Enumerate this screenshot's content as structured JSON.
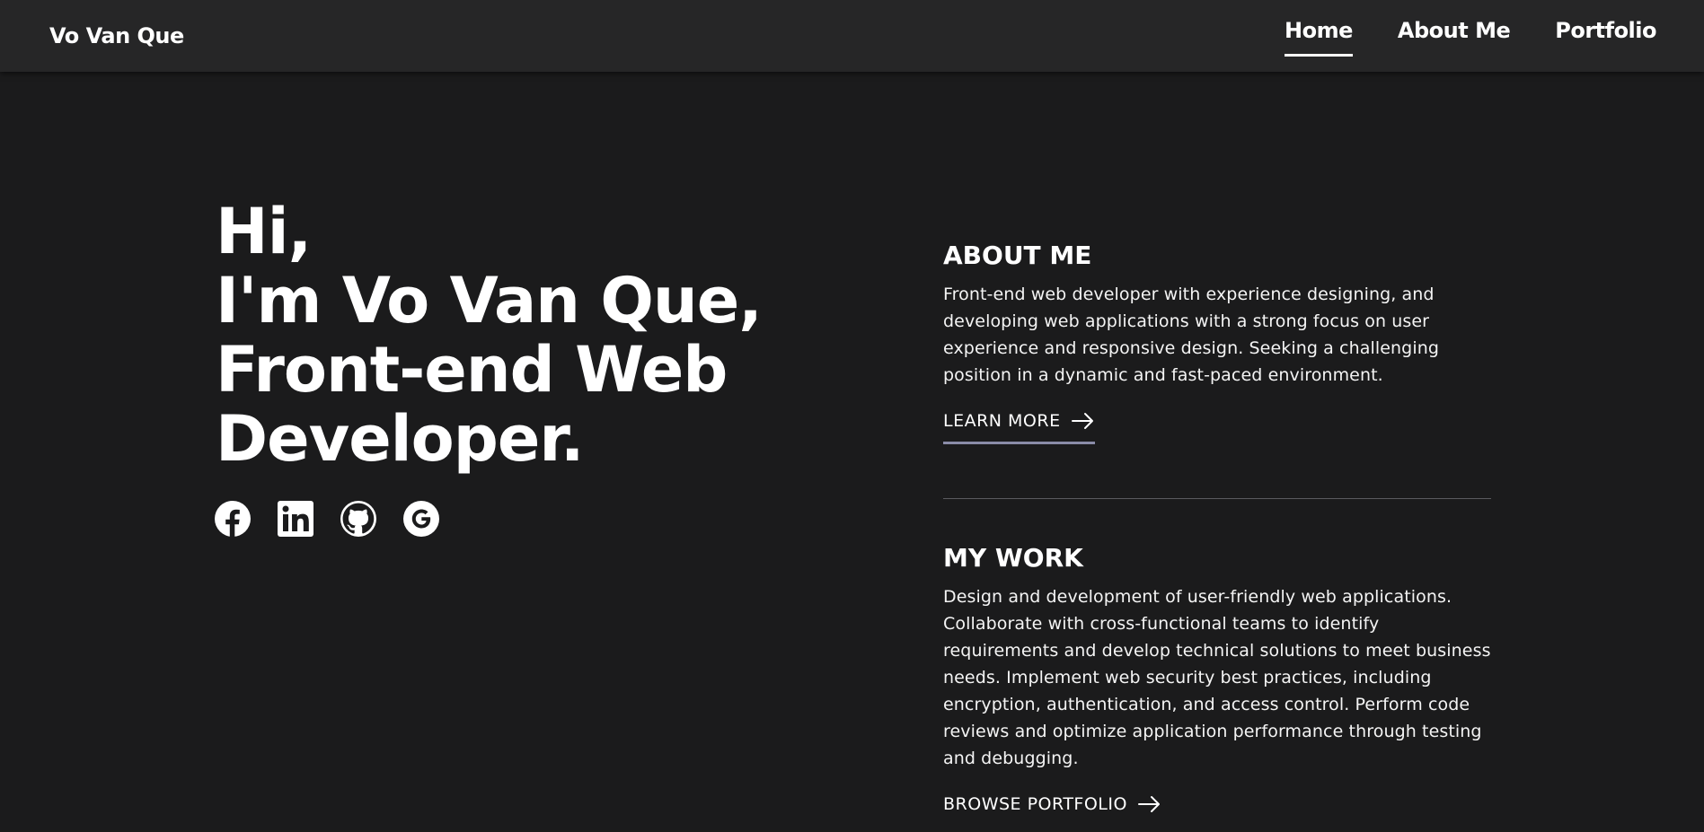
{
  "navbar": {
    "brand": "Vo Van Que",
    "links": [
      {
        "label": "Home",
        "active": true
      },
      {
        "label": "About Me",
        "active": false
      },
      {
        "label": "Portfolio",
        "active": false
      }
    ]
  },
  "hero": {
    "lines": [
      "Hi,",
      "I'm Vo Van Que,",
      "Front-end Web",
      "Developer."
    ]
  },
  "socials": [
    {
      "icon": "facebook-icon"
    },
    {
      "icon": "linkedin-icon"
    },
    {
      "icon": "github-icon"
    },
    {
      "icon": "google-icon"
    }
  ],
  "about": {
    "title": "ABOUT ME",
    "text": "Front-end web developer with experience designing, and developing web applications with a strong focus on user experience and responsive design. Seeking a challenging position in a dynamic and fast-paced environment.",
    "cta": "LEARN MORE"
  },
  "work": {
    "title": "MY WORK",
    "text": "Design and development of user-friendly web applications. Collaborate with cross-functional teams to identify requirements and develop technical solutions to meet business needs. Implement web security best practices, including encryption, authentication, and access control. Perform code reviews and optimize application performance through testing and debugging.",
    "cta": "BROWSE PORTFOLIO"
  },
  "colors": {
    "background": "#1b1b1c",
    "navbar": "#262627",
    "cta_underline": "#8a8ca8"
  }
}
